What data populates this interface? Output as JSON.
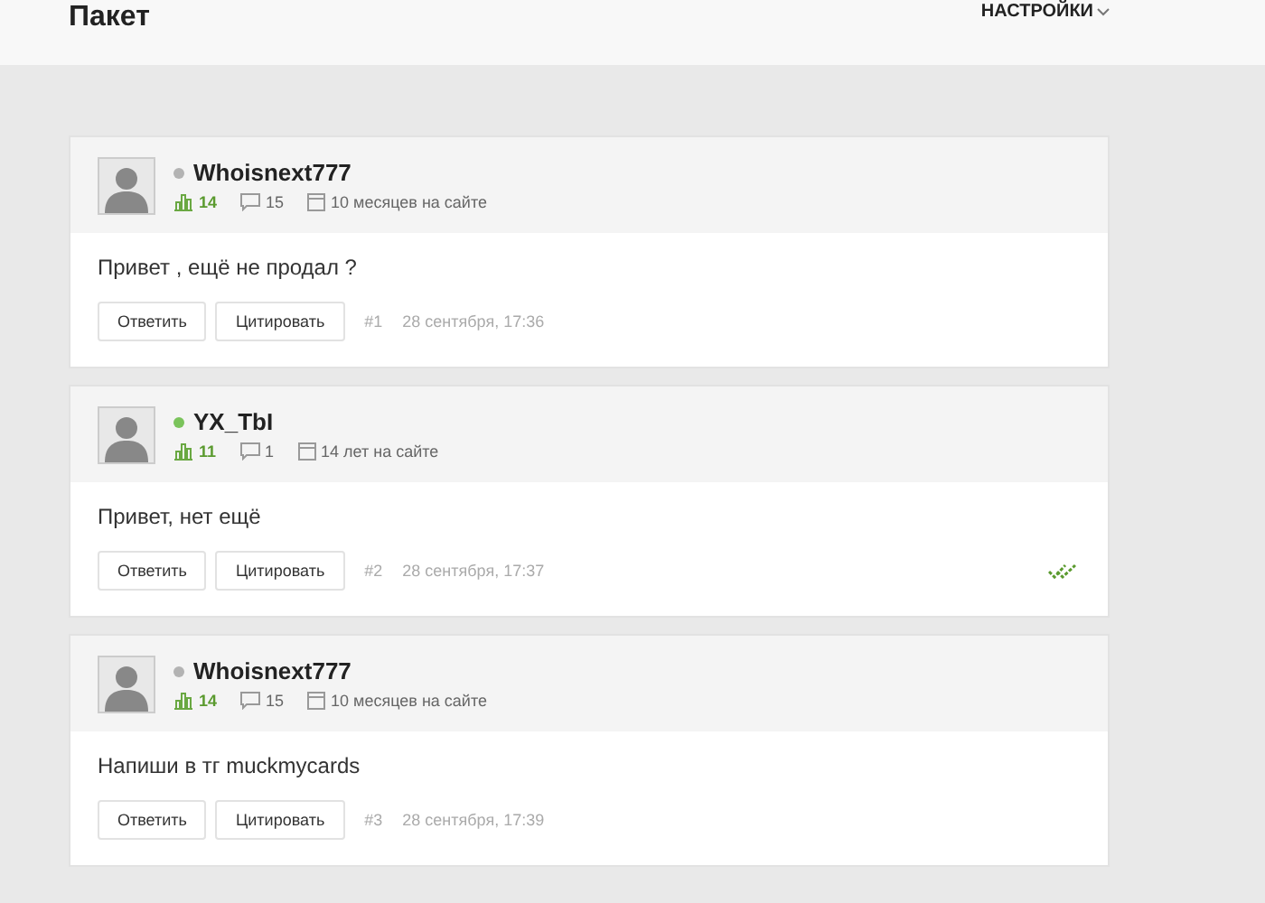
{
  "header": {
    "title": "Пакет",
    "settings": "НАСТРОЙКИ"
  },
  "posts": [
    {
      "author": "Whoisnext777",
      "online": false,
      "rating": "14",
      "messages": "15",
      "tenure": "10 месяцев на сайте",
      "text": "Привет , ещё не продал ?",
      "reply": "Ответить",
      "quote": "Цитировать",
      "number": "#1",
      "date": "28 сентября, 17:36",
      "read": false
    },
    {
      "author": "YX_TbI",
      "online": true,
      "rating": "11",
      "messages": "1",
      "tenure": "14 лет на сайте",
      "text": "Привет, нет ещё",
      "reply": "Ответить",
      "quote": "Цитировать",
      "number": "#2",
      "date": "28 сентября, 17:37",
      "read": true
    },
    {
      "author": "Whoisnext777",
      "online": false,
      "rating": "14",
      "messages": "15",
      "tenure": "10 месяцев на сайте",
      "text": "Напиши в тг muckmycards",
      "reply": "Ответить",
      "quote": "Цитировать",
      "number": "#3",
      "date": "28 сентября, 17:39",
      "read": false
    }
  ]
}
